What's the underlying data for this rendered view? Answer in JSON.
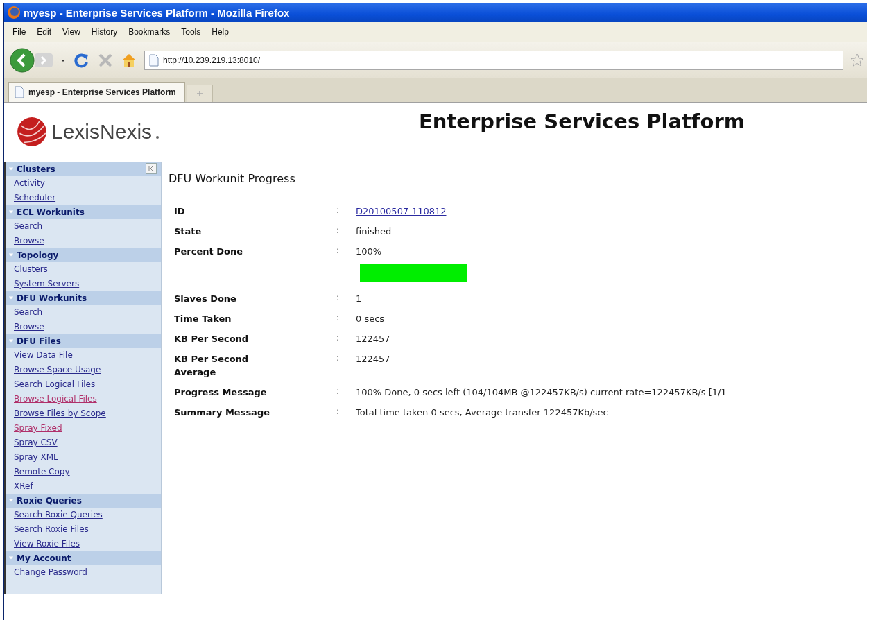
{
  "window": {
    "title": "myesp - Enterprise Services Platform - Mozilla Firefox"
  },
  "menu": [
    "File",
    "Edit",
    "View",
    "History",
    "Bookmarks",
    "Tools",
    "Help"
  ],
  "address": {
    "value": "http://10.239.219.13:8010/"
  },
  "tabs": [
    {
      "label": "myesp - Enterprise Services Platform",
      "selected": true
    }
  ],
  "page": {
    "logo": "LexisNexis",
    "title": "Enterprise Services Platform"
  },
  "sidebar": {
    "sections": [
      {
        "title": "Clusters",
        "expanded": true,
        "links": [
          {
            "label": "Activity",
            "visited": false
          },
          {
            "label": "Scheduler",
            "visited": false
          }
        ]
      },
      {
        "title": "ECL Workunits",
        "expanded": true,
        "links": [
          {
            "label": "Search",
            "visited": false
          },
          {
            "label": "Browse",
            "visited": false
          }
        ]
      },
      {
        "title": "Topology",
        "expanded": true,
        "links": [
          {
            "label": "Clusters",
            "visited": false
          },
          {
            "label": "System Servers",
            "visited": false
          }
        ]
      },
      {
        "title": "DFU Workunits",
        "expanded": true,
        "links": [
          {
            "label": "Search",
            "visited": false
          },
          {
            "label": "Browse",
            "visited": false
          }
        ]
      },
      {
        "title": "DFU Files",
        "expanded": true,
        "links": [
          {
            "label": "View Data File",
            "visited": false
          },
          {
            "label": "Browse Space Usage",
            "visited": false
          },
          {
            "label": "Search Logical Files",
            "visited": false
          },
          {
            "label": "Browse Logical Files",
            "visited": true
          },
          {
            "label": "Browse Files by Scope",
            "visited": false
          },
          {
            "label": "Spray Fixed",
            "visited": true
          },
          {
            "label": "Spray CSV",
            "visited": false
          },
          {
            "label": "Spray XML",
            "visited": false
          },
          {
            "label": "Remote Copy",
            "visited": false
          },
          {
            "label": "XRef",
            "visited": false
          }
        ]
      },
      {
        "title": "Roxie Queries",
        "expanded": true,
        "links": [
          {
            "label": "Search Roxie Queries",
            "visited": false
          },
          {
            "label": "Search Roxie Files",
            "visited": false
          },
          {
            "label": "View Roxie Files",
            "visited": false
          }
        ]
      },
      {
        "title": "My Account",
        "expanded": true,
        "links": [
          {
            "label": "Change Password",
            "visited": false
          }
        ]
      }
    ]
  },
  "content": {
    "heading": "DFU Workunit Progress",
    "fields": [
      {
        "kind": "link",
        "label": "ID",
        "separator": ":",
        "value": "D20100507-110812"
      },
      {
        "kind": "text",
        "label": "State",
        "separator": ":",
        "value": "finished"
      },
      {
        "kind": "progress",
        "label": "Percent Done",
        "separator": ":",
        "value": "100%"
      },
      {
        "kind": "text",
        "label": "Slaves Done",
        "separator": ":",
        "value": "1"
      },
      {
        "kind": "text",
        "label": "Time Taken",
        "separator": ":",
        "value": "0 secs"
      },
      {
        "kind": "text",
        "label": "KB Per Second",
        "separator": ":",
        "value": "122457"
      },
      {
        "kind": "text",
        "label": "KB Per Second Average",
        "separator": ":",
        "value": "122457"
      },
      {
        "kind": "text",
        "label": "Progress Message",
        "separator": ":",
        "value": "100% Done, 0 secs left (104/104MB @122457KB/s) current rate=122457KB/s [1/1"
      },
      {
        "kind": "text",
        "label": "Summary Message",
        "separator": ":",
        "value": "Total time taken 0 secs, Average transfer 122457Kb/sec"
      }
    ]
  }
}
